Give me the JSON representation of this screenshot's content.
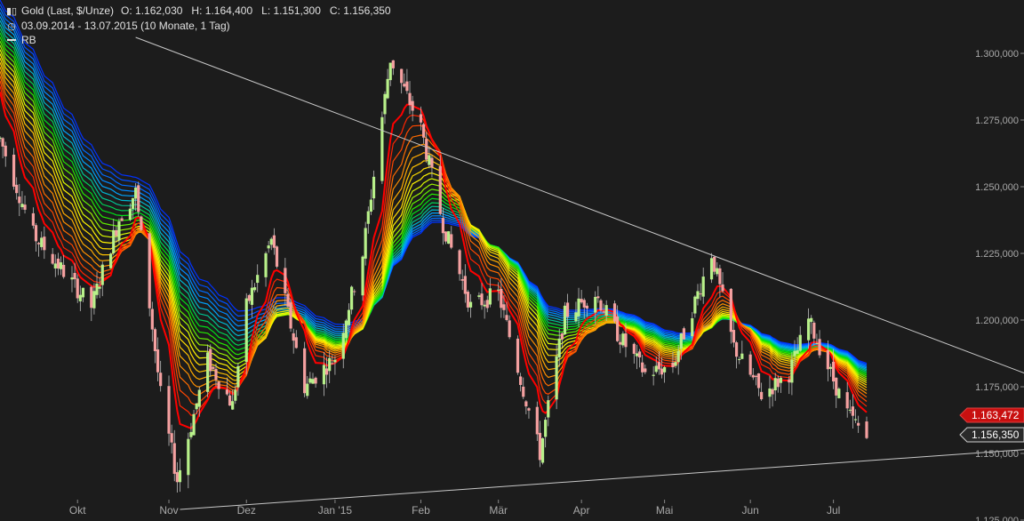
{
  "header": {
    "instrument": "Gold (Last, $/Unze)",
    "ohlc": "O: 1.162,030   H: 1.164,400   L: 1.151,300   C: 1.156,350",
    "range": "03.09.2014 - 13.07.2015 (10 Monate, 1 Tag)",
    "indicator": "RB",
    "icons": [
      "candlestick-icon",
      "clock-icon",
      "line-legend-icon"
    ]
  },
  "price_tags": {
    "upper": "1.163,472",
    "lower": "1.156,350"
  },
  "colors": {
    "background": "#1c1c1c",
    "candle_up": "#b8f08a",
    "candle_down": "#f4a0a0",
    "trendline": "#c8c8c8",
    "upper_tag": "#c81010",
    "lower_tag": "#2a2a2a"
  },
  "chart_data": {
    "type": "candlestick",
    "title": "Gold (Last, $/Unze)",
    "y_ticks": [
      "1.300,000",
      "1.275,000",
      "1.250,000",
      "1.225,000",
      "1.200,000",
      "1.175,000",
      "1.150,000",
      "1.125,000"
    ],
    "y_tick_values": [
      1300,
      1275,
      1250,
      1225,
      1200,
      1175,
      1150,
      1125
    ],
    "x_ticks": [
      "Okt",
      "Nov",
      "Dez",
      "Jan '15",
      "Feb",
      "Mär",
      "Apr",
      "Mai",
      "Jun",
      "Jul"
    ],
    "x_tick_dates": [
      "2014-10-01",
      "2014-11-03",
      "2014-12-01",
      "2015-01-02",
      "2015-02-02",
      "2015-03-02",
      "2015-04-01",
      "2015-05-01",
      "2015-06-01",
      "2015-07-01"
    ],
    "date_range": [
      "2014-09-03",
      "2015-07-13"
    ],
    "ylim": [
      1120,
      1312
    ],
    "price_path": [
      [
        "2014-09-03",
        1268
      ],
      [
        "2014-09-15",
        1232
      ],
      [
        "2014-09-26",
        1218
      ],
      [
        "2014-10-06",
        1205
      ],
      [
        "2014-10-16",
        1238
      ],
      [
        "2014-10-22",
        1248
      ],
      [
        "2014-10-31",
        1172
      ],
      [
        "2014-11-06",
        1140
      ],
      [
        "2014-11-17",
        1185
      ],
      [
        "2014-11-26",
        1168
      ],
      [
        "2014-12-01",
        1205
      ],
      [
        "2014-12-10",
        1230
      ],
      [
        "2014-12-22",
        1175
      ],
      [
        "2015-01-02",
        1186
      ],
      [
        "2015-01-12",
        1225
      ],
      [
        "2015-01-22",
        1298
      ],
      [
        "2015-02-02",
        1272
      ],
      [
        "2015-02-10",
        1236
      ],
      [
        "2015-02-20",
        1205
      ],
      [
        "2015-03-02",
        1210
      ],
      [
        "2015-03-17",
        1150
      ],
      [
        "2015-03-26",
        1202
      ],
      [
        "2015-04-06",
        1210
      ],
      [
        "2015-04-14",
        1195
      ],
      [
        "2015-04-24",
        1180
      ],
      [
        "2015-05-04",
        1183
      ],
      [
        "2015-05-18",
        1225
      ],
      [
        "2015-05-26",
        1190
      ],
      [
        "2015-06-05",
        1172
      ],
      [
        "2015-06-15",
        1180
      ],
      [
        "2015-06-22",
        1200
      ],
      [
        "2015-07-06",
        1165
      ],
      [
        "2015-07-13",
        1156
      ]
    ],
    "upper_trendline": [
      [
        "2014-10-22",
        1306
      ],
      [
        "2015-07-13",
        1193
      ]
    ],
    "lower_trendline": [
      [
        "2014-11-07",
        1129
      ],
      [
        "2015-07-13",
        1149
      ]
    ],
    "last_values": {
      "ribbon_top": 1163.472,
      "close": 1156.35
    },
    "ribbon": {
      "name": "RB",
      "count": 22,
      "color_range": [
        "#ff0000",
        "#ffb400",
        "#ffff00",
        "#00ff00",
        "#00a0ff",
        "#0030ff"
      ]
    },
    "grid": false
  }
}
